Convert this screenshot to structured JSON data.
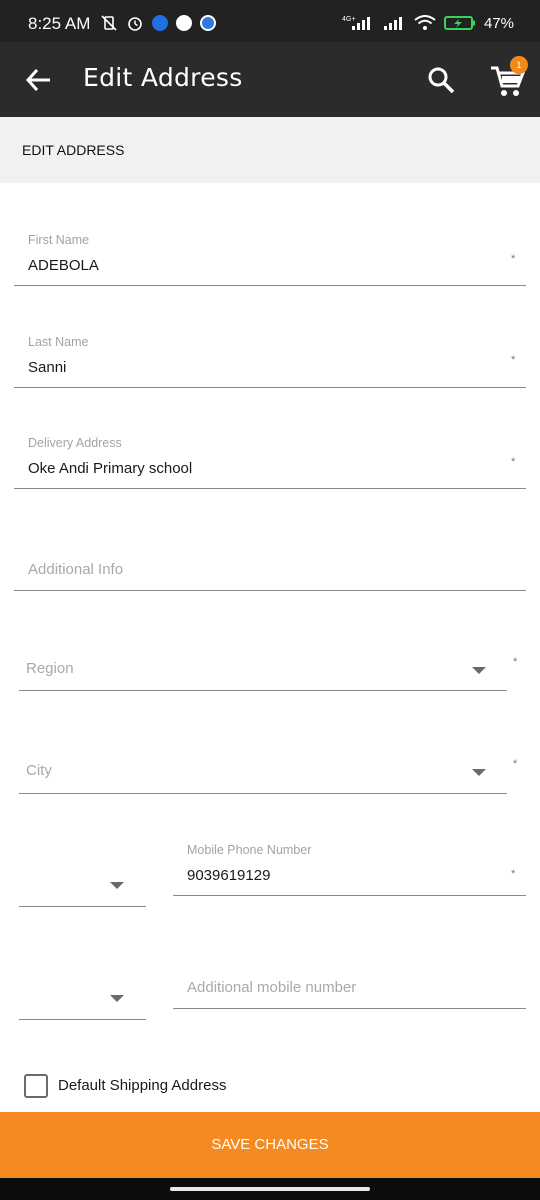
{
  "status_bar": {
    "time": "8:25 AM",
    "battery": "47%",
    "network": "4G+"
  },
  "app_bar": {
    "title": "Edit Address",
    "cart_count": "1"
  },
  "section": {
    "title": "EDIT ADDRESS"
  },
  "form": {
    "first_name": {
      "label": "First Name",
      "value": "ADEBOLA",
      "required": "*"
    },
    "last_name": {
      "label": "Last Name",
      "value": "Sanni",
      "required": "*"
    },
    "delivery_address": {
      "label": "Delivery Address",
      "value": "Oke Andi Primary school",
      "required": "*"
    },
    "additional_info": {
      "placeholder": "Additional Info"
    },
    "region": {
      "placeholder": "Region",
      "required": "*"
    },
    "city": {
      "placeholder": "City",
      "required": "*"
    },
    "mobile_phone": {
      "label": "Mobile Phone Number",
      "value": "9039619129",
      "required": "*"
    },
    "additional_mobile": {
      "placeholder": "Additional mobile number"
    },
    "default_shipping": {
      "label": "Default Shipping Address",
      "checked": false
    }
  },
  "actions": {
    "save_label": "SAVE CHANGES"
  },
  "colors": {
    "app_bar": "#2b2b2b",
    "accent": "#f48a21",
    "section_bg": "#f1f1f1"
  }
}
